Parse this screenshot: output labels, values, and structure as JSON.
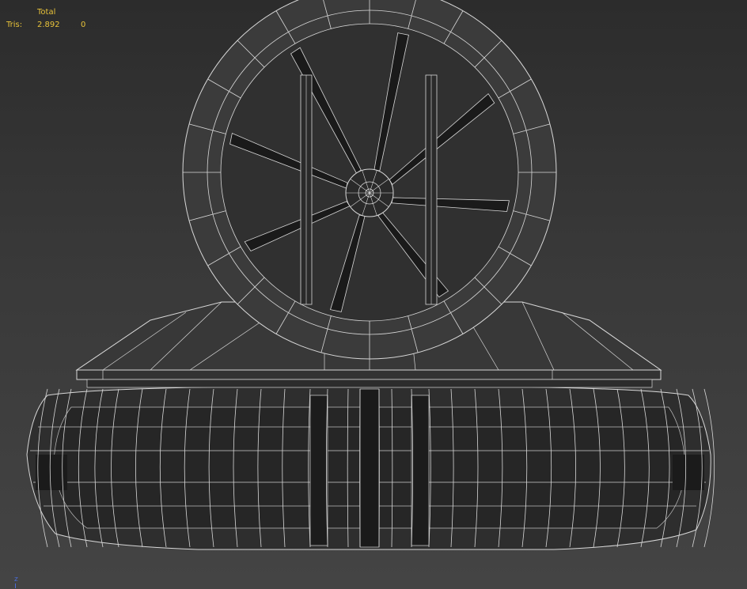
{
  "stats": {
    "header": "Total",
    "tris_label": "Tris:",
    "tris_total": "2.892",
    "tris_selected": "0",
    "color": "#e8c23a"
  },
  "axis_gizmo": {
    "label": "z",
    "color": "#4a6bd6"
  },
  "viewport": {
    "background": "#3a3a3a",
    "wire_color": "#d8d8d8"
  }
}
